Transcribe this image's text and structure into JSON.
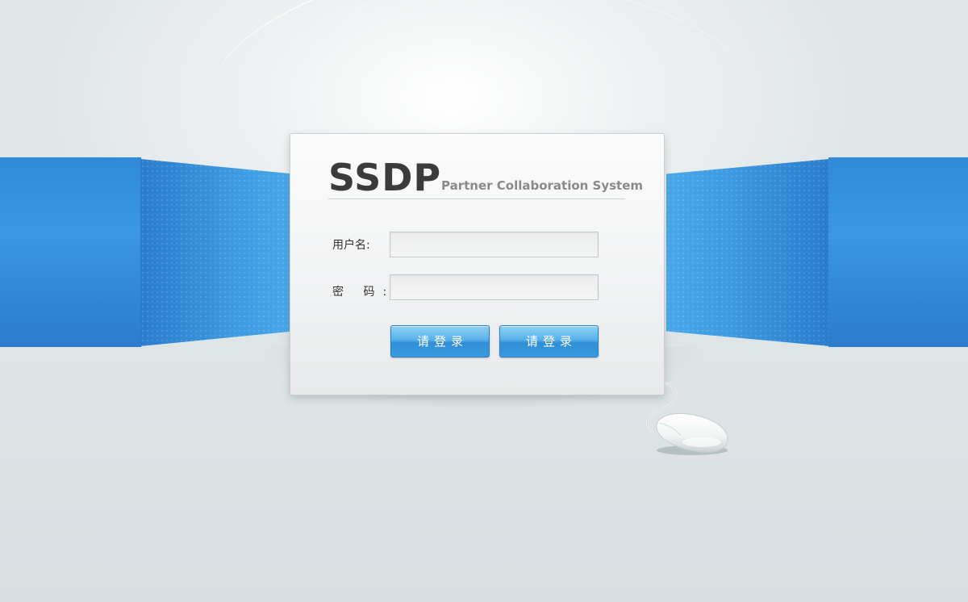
{
  "brand": {
    "title": "SSDP",
    "subtitle": "Partner Collaboration System"
  },
  "form": {
    "username_label": "用户名:",
    "username_value": "",
    "password_label": "密  码:",
    "password_value": "",
    "buttons": [
      {
        "label": "请登录"
      },
      {
        "label": "请登录"
      }
    ]
  },
  "decor": {
    "mouse": "computer-mouse-icon"
  },
  "colors": {
    "accent_blue": "#3a97e0",
    "button_blue": "#3a9be0",
    "background": "#dce3e5"
  }
}
